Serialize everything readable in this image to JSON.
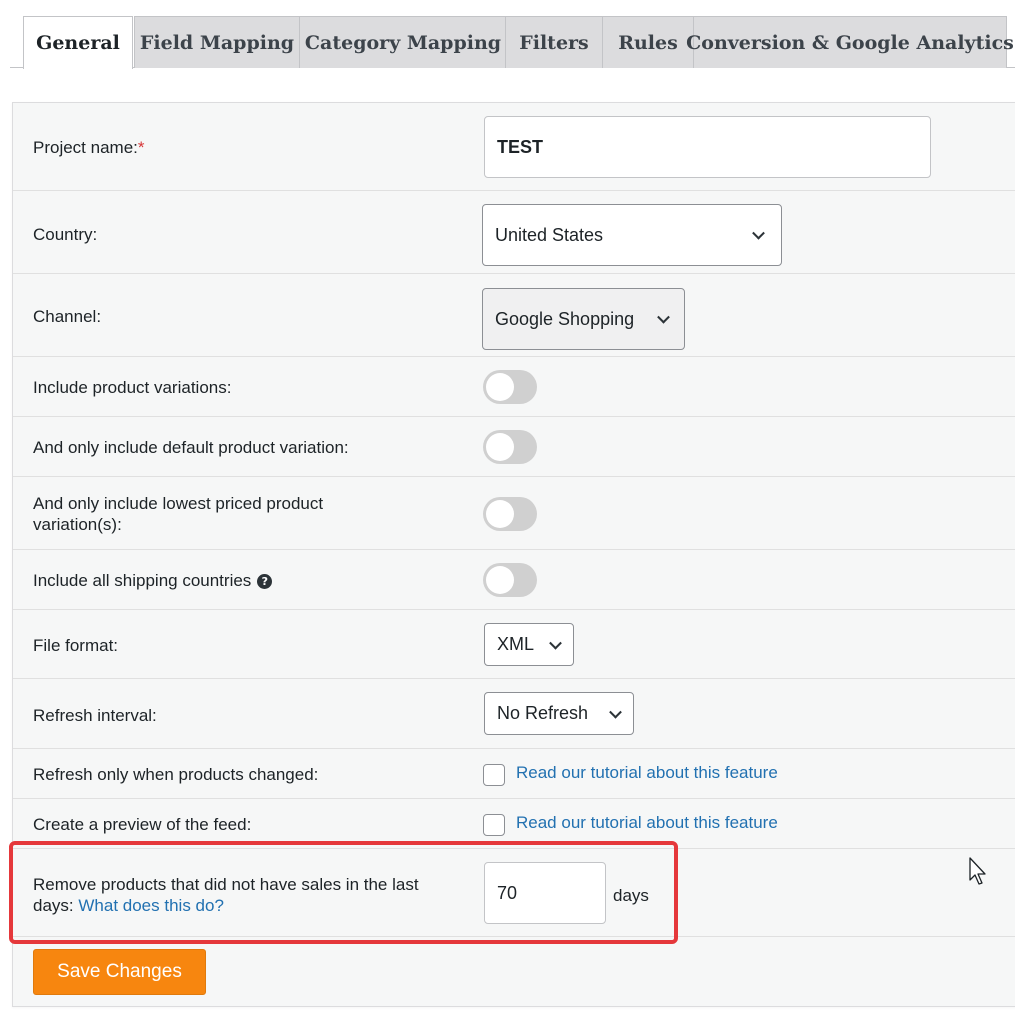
{
  "tabs": [
    {
      "label": "General",
      "active": true
    },
    {
      "label": "Field Mapping",
      "active": false
    },
    {
      "label": "Category Mapping",
      "active": false
    },
    {
      "label": "Filters",
      "active": false
    },
    {
      "label": "Rules",
      "active": false
    },
    {
      "label": "Conversion & Google Analytics",
      "active": false
    }
  ],
  "form": {
    "project_name": {
      "label": "Project name:",
      "required_mark": "*",
      "value": "TEST"
    },
    "country": {
      "label": "Country:",
      "value": "United States"
    },
    "channel": {
      "label": "Channel:",
      "value": "Google Shopping"
    },
    "include_variations": {
      "label": "Include product variations:",
      "on": false
    },
    "default_variation": {
      "label": "And only include default product variation:",
      "on": false
    },
    "lowest_priced": {
      "label": "And only include lowest priced product variation(s):",
      "on": false
    },
    "shipping_countries": {
      "label": "Include all shipping countries",
      "help_icon": "question-circle-icon",
      "help_glyph": "?",
      "on": false
    },
    "file_format": {
      "label": "File format:",
      "value": "XML"
    },
    "refresh_interval": {
      "label": "Refresh interval:",
      "value": "No Refresh"
    },
    "refresh_changed": {
      "label": "Refresh only when products changed:",
      "checked": false,
      "link": "Read our tutorial about this feature"
    },
    "preview": {
      "label": "Create a preview of the feed:",
      "checked": false,
      "link": "Read our tutorial about this feature"
    },
    "remove_products": {
      "label": "Remove products that did not have sales in the last days:",
      "link": "What does this do?",
      "value": "70",
      "unit": "days"
    }
  },
  "save_button": "Save Changes",
  "colors": {
    "accent": "#f7860f",
    "link": "#2271b1",
    "highlight": "#e5383b"
  }
}
